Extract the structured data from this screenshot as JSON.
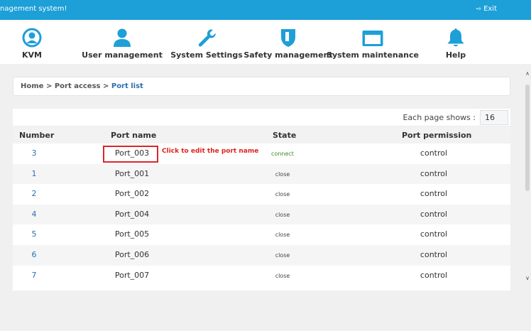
{
  "topbar": {
    "welcome": "nagement system!",
    "exit": "Exit"
  },
  "nav": [
    {
      "id": "kvm",
      "label": "KVM",
      "icon": "user-circle-icon"
    },
    {
      "id": "user",
      "label": "User management",
      "icon": "user-icon"
    },
    {
      "id": "system",
      "label": "System Settings",
      "icon": "wrench-icon"
    },
    {
      "id": "safety",
      "label": "Safety management",
      "icon": "shield-icon"
    },
    {
      "id": "maint",
      "label": "System maintenance",
      "icon": "monitor-icon"
    },
    {
      "id": "help",
      "label": "Help",
      "icon": "bell-icon"
    }
  ],
  "breadcrumb": {
    "home": "Home",
    "section": "Port access",
    "current": "Port list",
    "separator": ">"
  },
  "pager": {
    "label": "Each page shows :",
    "value": "16"
  },
  "table": {
    "headers": {
      "number": "Number",
      "name": "Port name",
      "state": "State",
      "permission": "Port permission"
    },
    "rows": [
      {
        "number": "3",
        "name": "Port_003",
        "state": "connect",
        "permission": "control"
      },
      {
        "number": "1",
        "name": "Port_001",
        "state": "close",
        "permission": "control"
      },
      {
        "number": "2",
        "name": "Port_002",
        "state": "close",
        "permission": "control"
      },
      {
        "number": "4",
        "name": "Port_004",
        "state": "close",
        "permission": "control"
      },
      {
        "number": "5",
        "name": "Port_005",
        "state": "close",
        "permission": "control"
      },
      {
        "number": "6",
        "name": "Port_006",
        "state": "close",
        "permission": "control"
      },
      {
        "number": "7",
        "name": "Port_007",
        "state": "close",
        "permission": "control"
      }
    ]
  },
  "annotation": "Click to edit the port name",
  "colors": {
    "topbar": "#1d9fd7",
    "icon": "#1d9fd7",
    "link": "#2c6fb1",
    "connect": "#3a8a22",
    "annotation": "#e0231c"
  }
}
